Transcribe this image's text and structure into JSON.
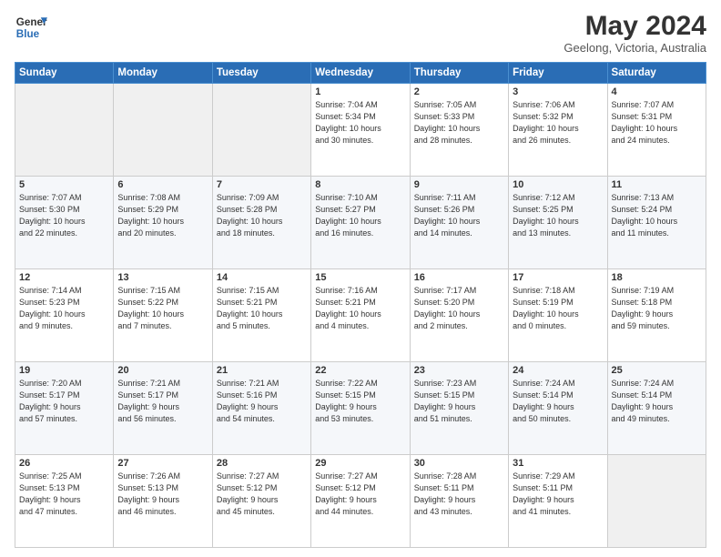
{
  "header": {
    "logo_line1": "General",
    "logo_line2": "Blue",
    "title": "May 2024",
    "subtitle": "Geelong, Victoria, Australia"
  },
  "calendar": {
    "days_of_week": [
      "Sunday",
      "Monday",
      "Tuesday",
      "Wednesday",
      "Thursday",
      "Friday",
      "Saturday"
    ],
    "weeks": [
      [
        {
          "day": "",
          "info": ""
        },
        {
          "day": "",
          "info": ""
        },
        {
          "day": "",
          "info": ""
        },
        {
          "day": "1",
          "info": "Sunrise: 7:04 AM\nSunset: 5:34 PM\nDaylight: 10 hours\nand 30 minutes."
        },
        {
          "day": "2",
          "info": "Sunrise: 7:05 AM\nSunset: 5:33 PM\nDaylight: 10 hours\nand 28 minutes."
        },
        {
          "day": "3",
          "info": "Sunrise: 7:06 AM\nSunset: 5:32 PM\nDaylight: 10 hours\nand 26 minutes."
        },
        {
          "day": "4",
          "info": "Sunrise: 7:07 AM\nSunset: 5:31 PM\nDaylight: 10 hours\nand 24 minutes."
        }
      ],
      [
        {
          "day": "5",
          "info": "Sunrise: 7:07 AM\nSunset: 5:30 PM\nDaylight: 10 hours\nand 22 minutes."
        },
        {
          "day": "6",
          "info": "Sunrise: 7:08 AM\nSunset: 5:29 PM\nDaylight: 10 hours\nand 20 minutes."
        },
        {
          "day": "7",
          "info": "Sunrise: 7:09 AM\nSunset: 5:28 PM\nDaylight: 10 hours\nand 18 minutes."
        },
        {
          "day": "8",
          "info": "Sunrise: 7:10 AM\nSunset: 5:27 PM\nDaylight: 10 hours\nand 16 minutes."
        },
        {
          "day": "9",
          "info": "Sunrise: 7:11 AM\nSunset: 5:26 PM\nDaylight: 10 hours\nand 14 minutes."
        },
        {
          "day": "10",
          "info": "Sunrise: 7:12 AM\nSunset: 5:25 PM\nDaylight: 10 hours\nand 13 minutes."
        },
        {
          "day": "11",
          "info": "Sunrise: 7:13 AM\nSunset: 5:24 PM\nDaylight: 10 hours\nand 11 minutes."
        }
      ],
      [
        {
          "day": "12",
          "info": "Sunrise: 7:14 AM\nSunset: 5:23 PM\nDaylight: 10 hours\nand 9 minutes."
        },
        {
          "day": "13",
          "info": "Sunrise: 7:15 AM\nSunset: 5:22 PM\nDaylight: 10 hours\nand 7 minutes."
        },
        {
          "day": "14",
          "info": "Sunrise: 7:15 AM\nSunset: 5:21 PM\nDaylight: 10 hours\nand 5 minutes."
        },
        {
          "day": "15",
          "info": "Sunrise: 7:16 AM\nSunset: 5:21 PM\nDaylight: 10 hours\nand 4 minutes."
        },
        {
          "day": "16",
          "info": "Sunrise: 7:17 AM\nSunset: 5:20 PM\nDaylight: 10 hours\nand 2 minutes."
        },
        {
          "day": "17",
          "info": "Sunrise: 7:18 AM\nSunset: 5:19 PM\nDaylight: 10 hours\nand 0 minutes."
        },
        {
          "day": "18",
          "info": "Sunrise: 7:19 AM\nSunset: 5:18 PM\nDaylight: 9 hours\nand 59 minutes."
        }
      ],
      [
        {
          "day": "19",
          "info": "Sunrise: 7:20 AM\nSunset: 5:17 PM\nDaylight: 9 hours\nand 57 minutes."
        },
        {
          "day": "20",
          "info": "Sunrise: 7:21 AM\nSunset: 5:17 PM\nDaylight: 9 hours\nand 56 minutes."
        },
        {
          "day": "21",
          "info": "Sunrise: 7:21 AM\nSunset: 5:16 PM\nDaylight: 9 hours\nand 54 minutes."
        },
        {
          "day": "22",
          "info": "Sunrise: 7:22 AM\nSunset: 5:15 PM\nDaylight: 9 hours\nand 53 minutes."
        },
        {
          "day": "23",
          "info": "Sunrise: 7:23 AM\nSunset: 5:15 PM\nDaylight: 9 hours\nand 51 minutes."
        },
        {
          "day": "24",
          "info": "Sunrise: 7:24 AM\nSunset: 5:14 PM\nDaylight: 9 hours\nand 50 minutes."
        },
        {
          "day": "25",
          "info": "Sunrise: 7:24 AM\nSunset: 5:14 PM\nDaylight: 9 hours\nand 49 minutes."
        }
      ],
      [
        {
          "day": "26",
          "info": "Sunrise: 7:25 AM\nSunset: 5:13 PM\nDaylight: 9 hours\nand 47 minutes."
        },
        {
          "day": "27",
          "info": "Sunrise: 7:26 AM\nSunset: 5:13 PM\nDaylight: 9 hours\nand 46 minutes."
        },
        {
          "day": "28",
          "info": "Sunrise: 7:27 AM\nSunset: 5:12 PM\nDaylight: 9 hours\nand 45 minutes."
        },
        {
          "day": "29",
          "info": "Sunrise: 7:27 AM\nSunset: 5:12 PM\nDaylight: 9 hours\nand 44 minutes."
        },
        {
          "day": "30",
          "info": "Sunrise: 7:28 AM\nSunset: 5:11 PM\nDaylight: 9 hours\nand 43 minutes."
        },
        {
          "day": "31",
          "info": "Sunrise: 7:29 AM\nSunset: 5:11 PM\nDaylight: 9 hours\nand 41 minutes."
        },
        {
          "day": "",
          "info": ""
        }
      ]
    ]
  }
}
